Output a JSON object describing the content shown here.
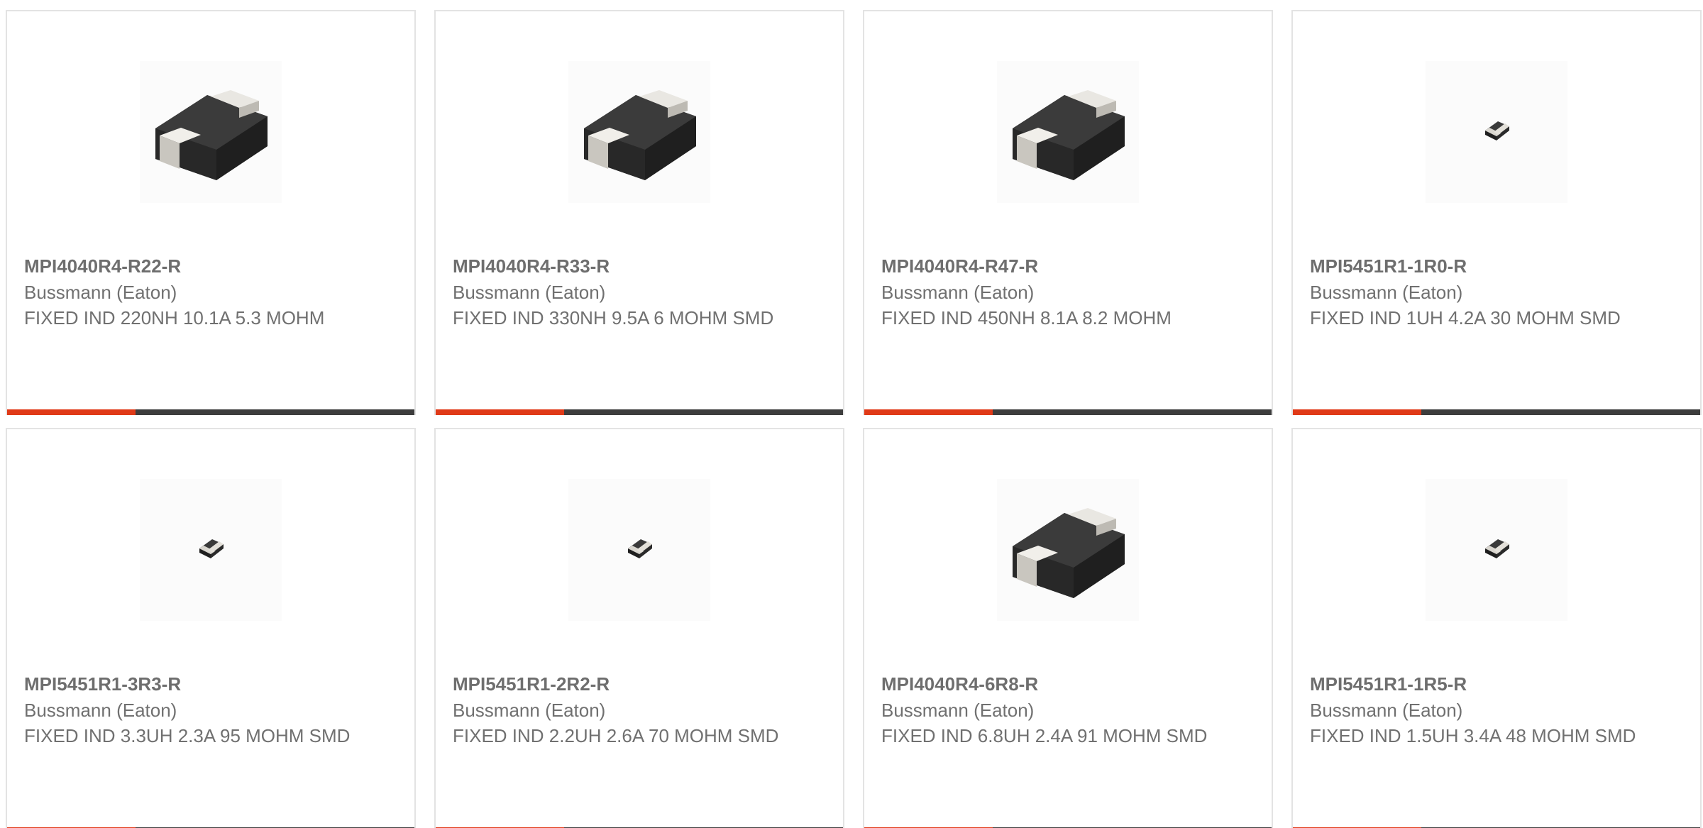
{
  "colors": {
    "accent": "#e03a18",
    "bar": "#3d3d3d",
    "border": "#e3e3e3",
    "text": "#707070"
  },
  "products": [
    {
      "part_number": "MPI4040R4-R22-R",
      "manufacturer": "Bussmann (Eaton)",
      "description": "FIXED IND 220NH 10.1A 5.3 MOHM",
      "image": "large-inductor"
    },
    {
      "part_number": "MPI4040R4-R33-R",
      "manufacturer": "Bussmann (Eaton)",
      "description": "FIXED IND 330NH 9.5A 6 MOHM SMD",
      "image": "large-inductor"
    },
    {
      "part_number": "MPI4040R4-R47-R",
      "manufacturer": "Bussmann (Eaton)",
      "description": "FIXED IND 450NH 8.1A 8.2 MOHM",
      "image": "large-inductor"
    },
    {
      "part_number": "MPI5451R1-1R0-R",
      "manufacturer": "Bussmann (Eaton)",
      "description": "FIXED IND 1UH 4.2A 30 MOHM SMD",
      "image": "small-inductor"
    },
    {
      "part_number": "MPI5451R1-3R3-R",
      "manufacturer": "Bussmann (Eaton)",
      "description": "FIXED IND 3.3UH 2.3A 95 MOHM SMD",
      "image": "small-inductor"
    },
    {
      "part_number": "MPI5451R1-2R2-R",
      "manufacturer": "Bussmann (Eaton)",
      "description": "FIXED IND 2.2UH 2.6A 70 MOHM SMD",
      "image": "small-inductor"
    },
    {
      "part_number": "MPI4040R4-6R8-R",
      "manufacturer": "Bussmann (Eaton)",
      "description": "FIXED IND 6.8UH 2.4A 91 MOHM SMD",
      "image": "large-inductor"
    },
    {
      "part_number": "MPI5451R1-1R5-R",
      "manufacturer": "Bussmann (Eaton)",
      "description": "FIXED IND 1.5UH 3.4A 48 MOHM SMD",
      "image": "small-inductor"
    }
  ]
}
